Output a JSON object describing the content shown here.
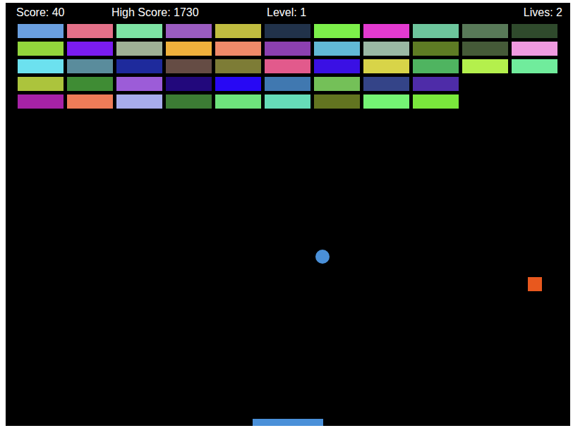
{
  "hud": {
    "score": "Score: 40",
    "high_score": "High Score: 1730",
    "level": "Level: 1",
    "lives": "Lives: 2"
  },
  "bricks": [
    [
      {
        "color": "#6a9fe0"
      },
      {
        "color": "#e47089"
      },
      {
        "color": "#7de3a4"
      },
      {
        "color": "#9a5cc0"
      },
      {
        "color": "#c0bc40"
      },
      {
        "color": "#21324a"
      },
      {
        "color": "#7cf04a"
      },
      {
        "color": "#e33ad0"
      },
      {
        "color": "#6dc59c"
      },
      {
        "color": "#587958"
      },
      {
        "color": "#2f4a2c"
      }
    ],
    [
      {
        "color": "#93d63c"
      },
      {
        "color": "#7a1cf0"
      },
      {
        "color": "#9fb196"
      },
      {
        "color": "#f0b13c"
      },
      {
        "color": "#ef8a6a"
      },
      {
        "color": "#8c40b0"
      },
      {
        "color": "#62b9d6"
      },
      {
        "color": "#9ab8a4"
      },
      {
        "color": "#5e7b24"
      },
      {
        "color": "#455a38"
      },
      {
        "color": "#f09ae0"
      }
    ],
    [
      {
        "color": "#6ce1ef"
      },
      {
        "color": "#5a8c9c"
      },
      {
        "color": "#1e2a9c"
      },
      {
        "color": "#654c44"
      },
      {
        "color": "#7d7c36"
      },
      {
        "color": "#e25a8c"
      },
      {
        "color": "#3a10e4"
      },
      {
        "color": "#d8d448"
      },
      {
        "color": "#4fb460"
      },
      {
        "color": "#b4f04c"
      },
      {
        "color": "#70ec9c"
      }
    ],
    [
      {
        "color": "#acc43c"
      },
      {
        "color": "#3f8c34"
      },
      {
        "color": "#9c5cd8"
      },
      {
        "color": "#22087c"
      },
      {
        "color": "#2808f4"
      },
      {
        "color": "#4078b0"
      },
      {
        "color": "#74c058"
      },
      {
        "color": "#344488"
      },
      {
        "color": "#4e2ca8"
      }
    ],
    [
      {
        "color": "#a622a6"
      },
      {
        "color": "#ee7c58"
      },
      {
        "color": "#a8acec"
      },
      {
        "color": "#3c7c34"
      },
      {
        "color": "#6ee47c"
      },
      {
        "color": "#66dcb8"
      },
      {
        "color": "#627420"
      },
      {
        "color": "#74f474"
      },
      {
        "color": "#7ae83c"
      }
    ]
  ]
}
